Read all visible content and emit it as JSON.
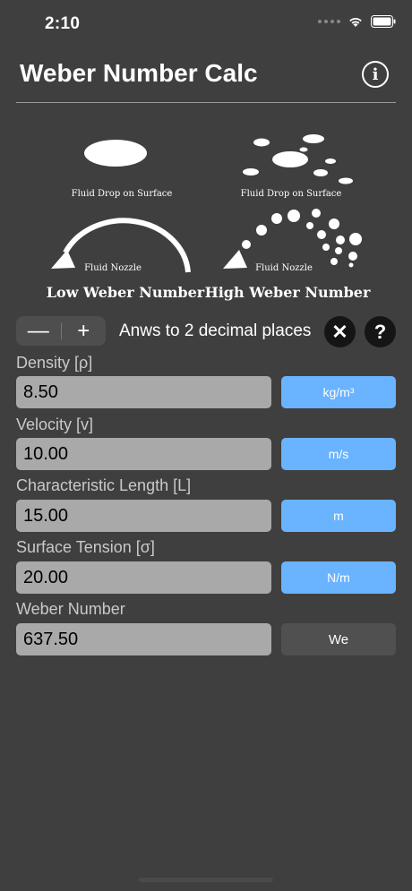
{
  "status_bar": {
    "time": "2:10"
  },
  "header": {
    "title": "Weber Number Calc",
    "info_icon": "i"
  },
  "illustration": {
    "drop_caption_left": "Fluid Drop on Surface",
    "drop_caption_right": "Fluid Drop on Surface",
    "nozzle_caption_left": "Fluid Nozzle",
    "nozzle_caption_right": "Fluid Nozzle",
    "low_label": "Low Weber Number",
    "high_label": "High Weber Number"
  },
  "controls": {
    "minus_label": "—",
    "plus_label": "+",
    "decimal_text": "Anws to 2 decimal places",
    "clear_icon": "✕",
    "help_icon": "?"
  },
  "fields": [
    {
      "label": "Density [ρ]",
      "value": "8.50",
      "unit": "kg/m³"
    },
    {
      "label": "Velocity [v]",
      "value": "10.00",
      "unit": "m/s"
    },
    {
      "label": "Characteristic Length [L]",
      "value": "15.00",
      "unit": "m"
    },
    {
      "label": "Surface Tension [σ]",
      "value": "20.00",
      "unit": "N/m"
    }
  ],
  "result": {
    "label": "Weber Number",
    "value": "637.50",
    "unit": "We"
  },
  "colors": {
    "background": "#3f3f3f",
    "input_bg": "#a9a9a9",
    "unit_blue": "#69b3ff",
    "result_unit_bg": "#505050"
  }
}
